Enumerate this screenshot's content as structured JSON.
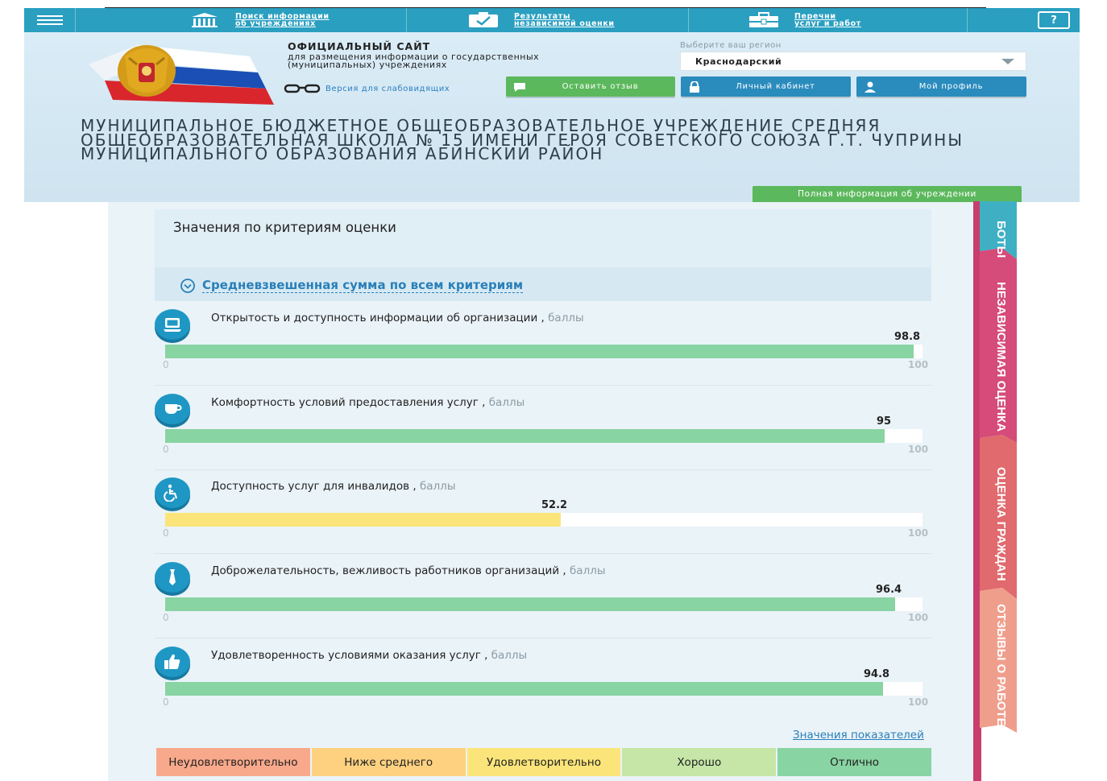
{
  "nav": {
    "search_line1": "Поиск информации",
    "search_line2": "об учреждениях",
    "results_line1": "Результаты",
    "results_line2": "независимой оценки",
    "lists_line1": "Перечни",
    "lists_line2": "услуг и работ",
    "help_label": "?"
  },
  "site": {
    "title": "ОФИЦИАЛЬНЫЙ САЙТ",
    "subtitle": "для размещения информации о государственных (муниципальных) учреждениях",
    "low_vision": "Версия для слабовидящих"
  },
  "region": {
    "label": "Выберите ваш регион",
    "value": "Краснодарский"
  },
  "buttons": {
    "feedback": "Оставить отзыв",
    "cabinet": "Личный кабинет",
    "profile": "Мой профиль",
    "full_info": "Полная информация об учреждении"
  },
  "org_name": "МУНИЦИПАЛЬНОЕ БЮДЖЕТНОЕ ОБЩЕОБРАЗОВАТЕЛЬНОЕ УЧРЕЖДЕНИЕ СРЕДНЯЯ ОБЩЕОБРАЗОВАТЕЛЬНАЯ ШКОЛА № 15 ИМЕНИ ГЕРОЯ СОВЕТСКОГО СОЮЗА Г.Т. ЧУПРИНЫ МУНИЦИПАЛЬНОГО ОБРАЗОВАНИЯ АБИНСКИЙ РАЙОН",
  "side_tabs": [
    "БОТЫ",
    "НЕЗАВИСИМАЯ ОЦЕНКА",
    "ОЦЕНКА ГРАЖДАН",
    "ОТЗЫВЫ О РАБОТЕ"
  ],
  "panel": {
    "title": "Значения по критериям оценки",
    "weighted_link": "Средневзвешенная сумма по всем критериям",
    "indicators_link": "Значения показателей"
  },
  "criteria": [
    {
      "label": "Открытость и доступность информации об организации",
      "unit": "баллы",
      "value": 98.8,
      "value_text": "98.8",
      "min": "0",
      "max": "100",
      "color": "#88d4a2",
      "icon": "monitor-icon"
    },
    {
      "label": "Комфортность условий предоставления услуг",
      "unit": "баллы",
      "value": 95,
      "value_text": "95",
      "min": "0",
      "max": "100",
      "color": "#88d4a2",
      "icon": "cup-icon"
    },
    {
      "label": "Доступность услуг для инвалидов",
      "unit": "баллы",
      "value": 52.2,
      "value_text": "52.2",
      "min": "0",
      "max": "100",
      "color": "#fbe57a",
      "icon": "wheelchair-icon"
    },
    {
      "label": "Доброжелательность, вежливость работников организаций",
      "unit": "баллы",
      "value": 96.4,
      "value_text": "96.4",
      "min": "0",
      "max": "100",
      "color": "#88d4a2",
      "icon": "tie-icon"
    },
    {
      "label": "Удовлетворенность условиями оказания услуг",
      "unit": "баллы",
      "value": 94.8,
      "value_text": "94.8",
      "min": "0",
      "max": "100",
      "color": "#88d4a2",
      "icon": "thumbs-up-icon"
    }
  ],
  "legend": [
    {
      "label": "Неудовлетворительно",
      "color": "#f9a98b"
    },
    {
      "label": "Ниже среднего",
      "color": "#fdd17f"
    },
    {
      "label": "Удовлетворительно",
      "color": "#fbe57a"
    },
    {
      "label": "Хорошо",
      "color": "#c5e6a6"
    },
    {
      "label": "Отлично",
      "color": "#88d4a2"
    }
  ]
}
